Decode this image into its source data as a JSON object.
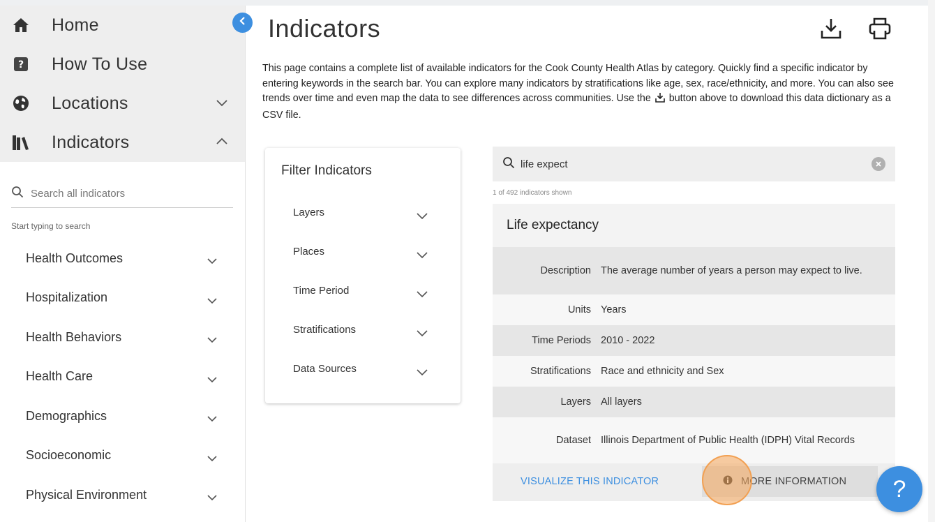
{
  "sidebar": {
    "nav": [
      {
        "label": "Home",
        "icon": "home-icon"
      },
      {
        "label": "How To Use",
        "icon": "question-box-icon"
      },
      {
        "label": "Locations",
        "icon": "globe-icon",
        "expanded": false
      },
      {
        "label": "Indicators",
        "icon": "books-icon",
        "expanded": true
      }
    ],
    "search_placeholder": "Search all indicators",
    "search_hint": "Start typing to search",
    "categories": [
      {
        "label": "Health Outcomes"
      },
      {
        "label": "Hospitalization"
      },
      {
        "label": "Health Behaviors"
      },
      {
        "label": "Health Care"
      },
      {
        "label": "Demographics"
      },
      {
        "label": "Socioeconomic"
      },
      {
        "label": "Physical Environment"
      }
    ]
  },
  "main": {
    "title": "Indicators",
    "intro_before_icon": "This page contains a complete list of available indicators for the Cook County Health Atlas by category. Quickly find a specific indicator by entering keywords in the search bar. You can explore many indicators by stratifications like age, sex, race/ethnicity, and more. You can also see trends over time and even map the data to see differences across communities. Use the",
    "intro_after_icon": "button above to download this data dictionary as a CSV file.",
    "filter": {
      "title": "Filter Indicators",
      "items": [
        {
          "label": "Layers"
        },
        {
          "label": "Places"
        },
        {
          "label": "Time Period"
        },
        {
          "label": "Stratifications"
        },
        {
          "label": "Data Sources"
        }
      ]
    },
    "results": {
      "query": "life expect",
      "count_text": "1 of 492 indicators shown",
      "card": {
        "title": "Life expectancy",
        "rows": [
          {
            "key": "Description",
            "value": "The average number of years a person may expect to live."
          },
          {
            "key": "Units",
            "value": "Years"
          },
          {
            "key": "Time Periods",
            "value": "2010 - 2022"
          },
          {
            "key": "Stratifications",
            "value": "Race and ethnicity and Sex"
          },
          {
            "key": "Layers",
            "value": "All layers"
          },
          {
            "key": "Dataset",
            "value": "Illinois Department of Public Health (IDPH) Vital Records"
          }
        ],
        "visualize_label": "VISUALIZE THIS INDICATOR",
        "more_info_label": "MORE INFORMATION"
      }
    }
  },
  "help_label": "?",
  "colors": {
    "accent": "#3d8fe0",
    "nav_bg": "#eeeeee",
    "click_marker": "#f2a052"
  }
}
